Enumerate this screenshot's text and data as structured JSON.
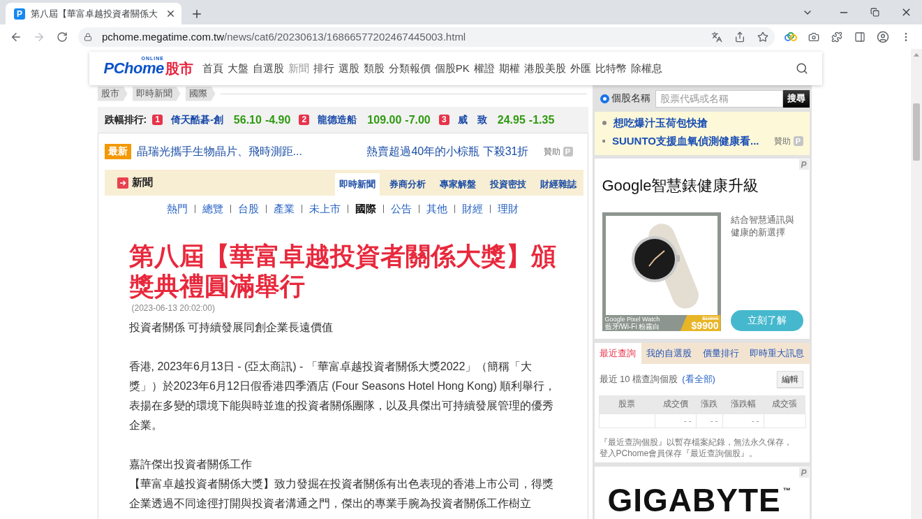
{
  "browser": {
    "tab": {
      "favicon": "P",
      "title": "第八屆【華富卓越投資者關係大"
    },
    "url": {
      "host": "pchome.megatime.com.tw",
      "path": "/news/cat6/20230613/16866577202467445003.html"
    }
  },
  "header": {
    "logo": {
      "wordmark": "PChome",
      "tagline": "ONLINE",
      "section": "股市"
    },
    "nav": [
      {
        "label": "首頁",
        "selected": false
      },
      {
        "label": "大盤",
        "selected": false
      },
      {
        "label": "自選股",
        "selected": false
      },
      {
        "label": "新聞",
        "selected": true
      },
      {
        "label": "排行",
        "selected": false
      },
      {
        "label": "選股",
        "selected": false
      },
      {
        "label": "類股",
        "selected": false
      },
      {
        "label": "分類報價",
        "selected": false
      },
      {
        "label": "個股PK",
        "selected": false
      },
      {
        "label": "權證",
        "selected": false
      },
      {
        "label": "期權",
        "selected": false
      },
      {
        "label": "港股美股",
        "selected": false
      },
      {
        "label": "外匯",
        "selected": false
      },
      {
        "label": "比特幣",
        "selected": false
      },
      {
        "label": "除權息",
        "selected": false
      }
    ]
  },
  "breadcrumb": [
    "股市",
    "即時新聞",
    "國際"
  ],
  "ranking": {
    "label": "跌幅排行:",
    "items": [
      {
        "rank": "1",
        "name": "倚天酷碁-創",
        "price": "56.10",
        "change": "-4.90"
      },
      {
        "rank": "2",
        "name": "龍德造船",
        "price": "109.00",
        "change": "-7.00"
      },
      {
        "rank": "3",
        "name": "威　致",
        "price": "24.95",
        "change": "-1.35"
      }
    ]
  },
  "latest": {
    "badge": "最新",
    "headline": "晶瑞光攜手生物晶片、飛時測距...",
    "promo": "熱賣超過40年的小棕瓶 下殺31折",
    "sponsor": "贊助",
    "sponsor_mark": "P"
  },
  "news_section": {
    "title": "新聞",
    "tabs": [
      {
        "label": "即時新聞",
        "selected": true
      },
      {
        "label": "券商分析",
        "selected": false
      },
      {
        "label": "專家解盤",
        "selected": false
      },
      {
        "label": "投資密技",
        "selected": false
      },
      {
        "label": "財經雜誌",
        "selected": false
      }
    ],
    "categories": [
      {
        "label": "熱門",
        "selected": false
      },
      {
        "label": "總覽",
        "selected": false
      },
      {
        "label": "台股",
        "selected": false
      },
      {
        "label": "產業",
        "selected": false
      },
      {
        "label": "未上市",
        "selected": false
      },
      {
        "label": "國際",
        "selected": true
      },
      {
        "label": "公告",
        "selected": false
      },
      {
        "label": "其他",
        "selected": false
      },
      {
        "label": "財經",
        "selected": false
      },
      {
        "label": "理財",
        "selected": false
      }
    ]
  },
  "article": {
    "title": "第八屆【華富卓越投資者關係大獎】頒獎典禮圓滿舉行",
    "date": "(2023-06-13 20:02:00)",
    "sections": [
      [
        "投資者關係 可持續發展同創企業長遠價值"
      ],
      [
        "香港, 2023年6月13日 - (亞太商訊) - 「華富卓越投資者關係大獎2022」（簡稱「大獎」）於2023年6月12日假香港四季酒店 (Four Seasons Hotel Hong Kong) 順利舉行，表揚在多變的環境下能與時並進的投資者關係團隊，以及具傑出可持續發展管理的優秀企業。"
      ],
      [
        "嘉許傑出投資者關係工作",
        "【華富卓越投資者關係大獎】致力發掘在投資者關係有出色表現的香港上市公司，得獎企業透過不同途徑打開與投資者溝通之門，傑出的專業手腕為投資者關係工作樹立"
      ]
    ]
  },
  "sidebar": {
    "stock_search": {
      "option": "個股名稱",
      "selected": true,
      "placeholder": "股票代碼或名稱",
      "button": "搜尋"
    },
    "sponsored_links": {
      "items": [
        "想吃爆汁玉荷包快搶",
        "SUUNTO支援血氧偵測健康看..."
      ],
      "sponsor": "贊助",
      "sponsor_mark": "P"
    },
    "watch_ad": {
      "ad_mark": "P",
      "headline": "Google智慧錶健康升級",
      "product": "Google Pixel Watch",
      "variant": "藍牙/Wi-Fi 粉霧白",
      "old_price": "$10900",
      "price": "$9900",
      "description": "結合智慧通訊與健康的新選擇",
      "cta": "立刻了解"
    },
    "quotes": {
      "tabs": [
        {
          "label": "最近查詢",
          "selected": true
        },
        {
          "label": "我的自選股",
          "selected": false
        },
        {
          "label": "價量排行",
          "selected": false
        },
        {
          "label": "即時重大訊息",
          "selected": false
        }
      ],
      "summary": "最近 10 檔查詢個股",
      "view_all": "(看全部)",
      "edit": "編輯",
      "table": {
        "columns": [
          "股票",
          "成交價",
          "漲跌",
          "漲跌幅",
          "成交張"
        ],
        "rows": [
          [
            null,
            "- -",
            "- -",
            "- -",
            null
          ]
        ]
      },
      "note": "『最近查詢個股』以暫存檔案紀錄，無法永久保存，登入PChome會員保存『最近查詢個股』。"
    },
    "brand_ad": {
      "ad_mark": "P",
      "logo": "GIGABYTE",
      "trademark": "™"
    }
  }
}
